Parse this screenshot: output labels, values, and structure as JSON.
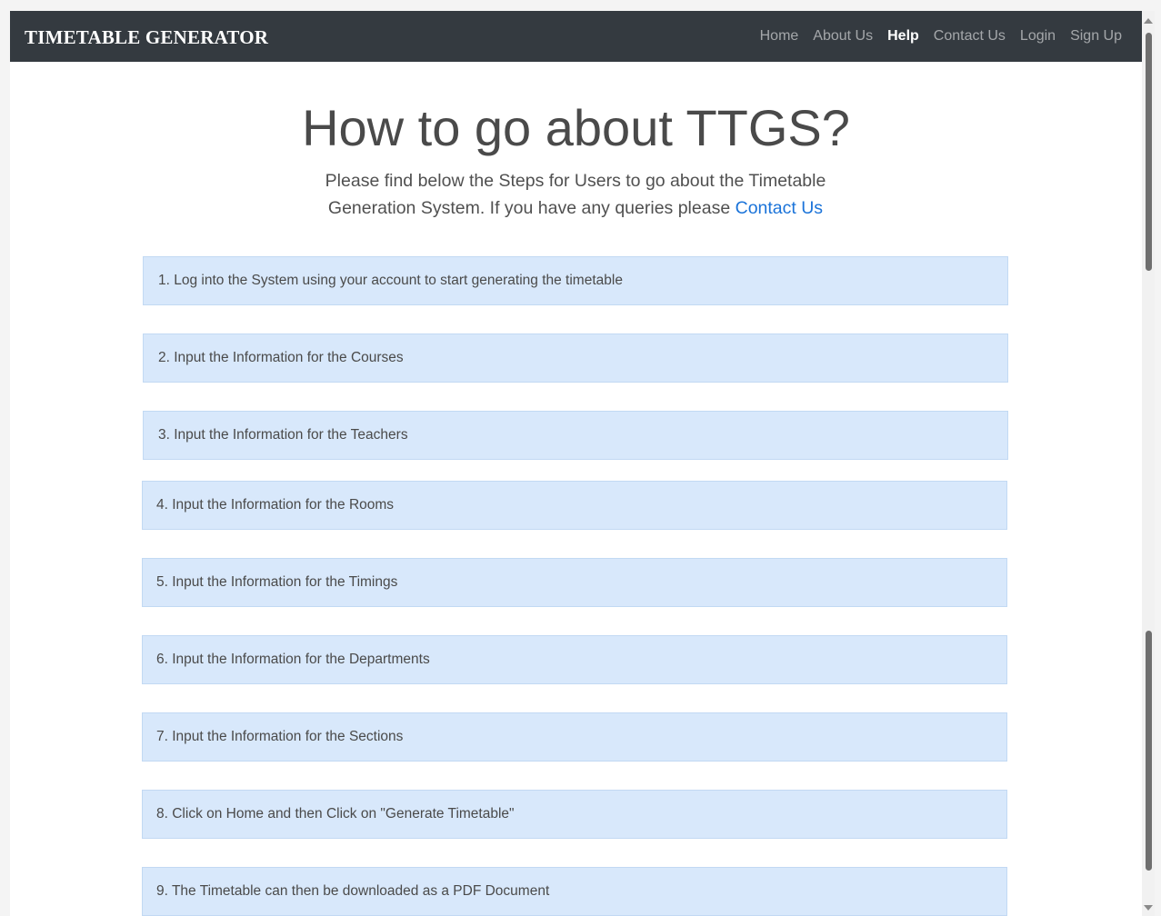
{
  "navbar": {
    "brand": "TIMETABLE GENERATOR",
    "links": [
      {
        "label": "Home",
        "active": false
      },
      {
        "label": "About Us",
        "active": false
      },
      {
        "label": "Help",
        "active": true
      },
      {
        "label": "Contact Us",
        "active": false
      },
      {
        "label": "Login",
        "active": false
      },
      {
        "label": "Sign Up",
        "active": false
      }
    ]
  },
  "main": {
    "heading": "How to go about TTGS?",
    "lead_text": "Please find below the Steps for Users to go about the Timetable Generation System. If you have any queries please",
    "lead_link": "Contact Us"
  },
  "steps": [
    "1. Log into the System using your account to start generating the timetable",
    "2. Input the Information for the Courses",
    "3. Input the Information for the Teachers",
    "4. Input the Information for the Rooms",
    "5. Input the Information for the Timings",
    "6. Input the Information for the Departments",
    "7. Input the Information for the Sections",
    "8. Click on Home and then Click on \"Generate Timetable\"",
    "9. The Timetable can then be downloaded as a PDF Document"
  ],
  "colors": {
    "navbar_bg": "#343a40",
    "step_bg": "#d8e8fb",
    "link": "#1a73d9"
  }
}
